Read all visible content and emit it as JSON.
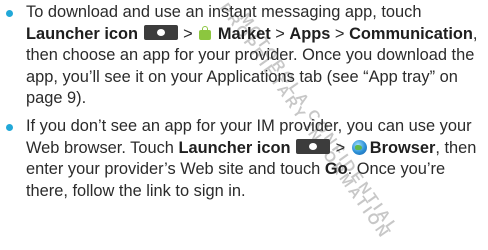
{
  "colors": {
    "bullet": "#22a8d8",
    "text": "#2b2b2b",
    "launcher_icon_bg": "#3c3c3c"
  },
  "watermark": {
    "line1": "MOTOROLA CONFIDENTIAL",
    "line2": "PROPRIETARY INFORMATION"
  },
  "item1": {
    "t1": "To download and use an instant messaging app, touch ",
    "launcher": "Launcher icon",
    "sep1": " > ",
    "market": "Market",
    "sep2": " > ",
    "apps": "Apps",
    "sep3": " > ",
    "communication": "Communication",
    "t2": ", then choose an app for your provider. Once you download the app, you’ll see it on your Applications tab (see “App tray” on page 9)."
  },
  "item2": {
    "t1": "If you don’t see an app for your IM provider, you can use your Web browser. Touch ",
    "launcher": "Launcher icon",
    "sep1": " > ",
    "browser": "Browser",
    "t2": ", then enter your provider’s Web site and touch ",
    "go": "Go",
    "t3": ". Once you’re there, follow the link to sign in."
  },
  "icons": {
    "launcher": "launcher-icon",
    "market": "market-icon",
    "browser": "browser-icon"
  }
}
